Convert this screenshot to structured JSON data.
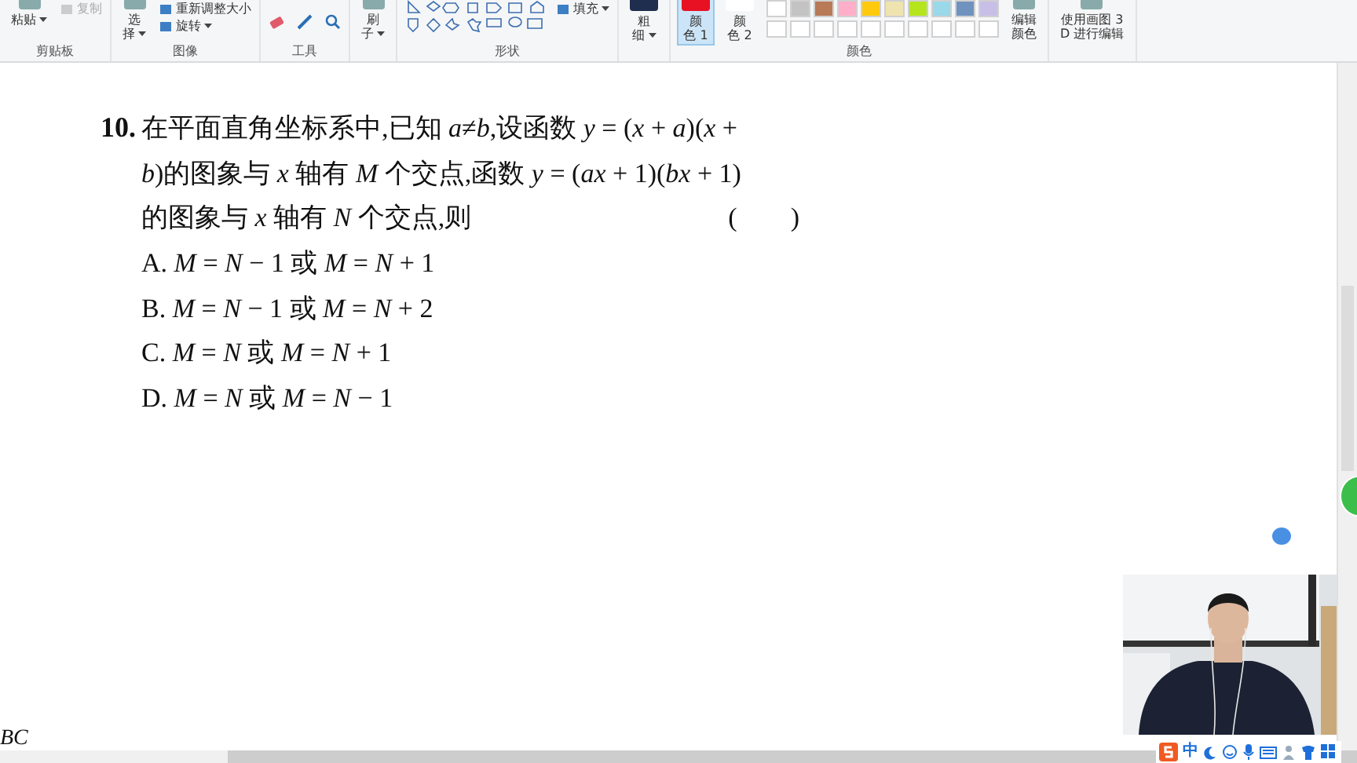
{
  "ribbon": {
    "groups": [
      {
        "label": "剪贴板",
        "buttons": [
          {
            "kind": "large",
            "lines": [
              "粘贴"
            ],
            "has_menu": true,
            "disabled": false
          },
          {
            "kind": "small",
            "lines": [
              "复制"
            ],
            "has_menu": false,
            "disabled": true
          }
        ]
      },
      {
        "label": "图像",
        "buttons": [
          {
            "kind": "large",
            "lines": [
              "选",
              "择"
            ],
            "has_menu": true,
            "disabled": false
          },
          {
            "kind": "small",
            "lines": [
              "重新调整大小"
            ],
            "has_menu": false,
            "disabled": false
          },
          {
            "kind": "small",
            "lines": [
              "旋转"
            ],
            "has_menu": true,
            "disabled": false
          }
        ]
      },
      {
        "label": "工具",
        "buttons": [
          {
            "kind": "tools"
          }
        ]
      },
      {
        "buttons": [
          {
            "kind": "large",
            "lines": [
              "刷",
              "子"
            ],
            "has_menu": true,
            "disabled": false
          }
        ]
      },
      {
        "label": "形状",
        "buttons": [
          {
            "kind": "shapes"
          },
          {
            "kind": "small",
            "lines": [
              "填充"
            ],
            "has_menu": true,
            "disabled": false
          }
        ]
      },
      {
        "buttons": [
          {
            "kind": "swatch",
            "lines": [
              "粗",
              "细"
            ],
            "has_menu": true,
            "color": "#1f2d4f",
            "selected": false
          }
        ]
      },
      {
        "label": "颜色",
        "buttons": [
          {
            "kind": "swatch",
            "lines": [
              "颜",
              "色 1"
            ],
            "has_menu": false,
            "color": "#e81123",
            "selected": true
          },
          {
            "kind": "swatch",
            "lines": [
              "颜",
              "色 2"
            ],
            "has_menu": false,
            "color": "#ffffff",
            "selected": false
          },
          {
            "kind": "palette",
            "colors": [
              {
                "color": "#ffffff"
              },
              {
                "color": "#c3c3c3"
              },
              {
                "color": "#b97a57"
              },
              {
                "color": "#ffaec9"
              },
              {
                "color": "#ffc90e"
              },
              {
                "color": "#efe4b0"
              },
              {
                "color": "#b5e61d"
              },
              {
                "color": "#99d9ea"
              },
              {
                "color": "#7092be"
              },
              {
                "color": "#c8bfe7"
              }
            ]
          },
          {
            "kind": "large",
            "lines": [
              "编辑",
              "颜色"
            ],
            "has_menu": false,
            "disabled": false
          }
        ]
      },
      {
        "buttons": [
          {
            "kind": "large",
            "lines": [
              "使用画图 3",
              "D 进行编辑"
            ],
            "has_menu": false,
            "disabled": false
          }
        ]
      }
    ]
  },
  "question": {
    "number": "10.",
    "lines": [
      "在平面直角坐标系中,已知 *a*≠*b*,设函数 *y* = (*x* + *a*)(*x* +",
      "*b*)的图象与 *x* 轴有 *M* 个交点,函数 *y* = (*ax* + 1)(*bx* + 1)",
      "的图象与 *x* 轴有 *N* 个交点,则"
    ],
    "blank": "(　　)",
    "options": [
      {
        "label": "A.",
        "text": "*M* = *N* − 1 或 *M* = *N* + 1"
      },
      {
        "label": "B.",
        "text": "*M* = *N* − 1 或 *M* = *N* + 2"
      },
      {
        "label": "C.",
        "text": "*M* = *N* 或 *M* = *N* + 1"
      },
      {
        "label": "D.",
        "text": "*M* = *N* 或 *M* = *N* − 1"
      }
    ]
  },
  "cut_text": "BC",
  "ime_bar": {
    "mode": "中"
  }
}
